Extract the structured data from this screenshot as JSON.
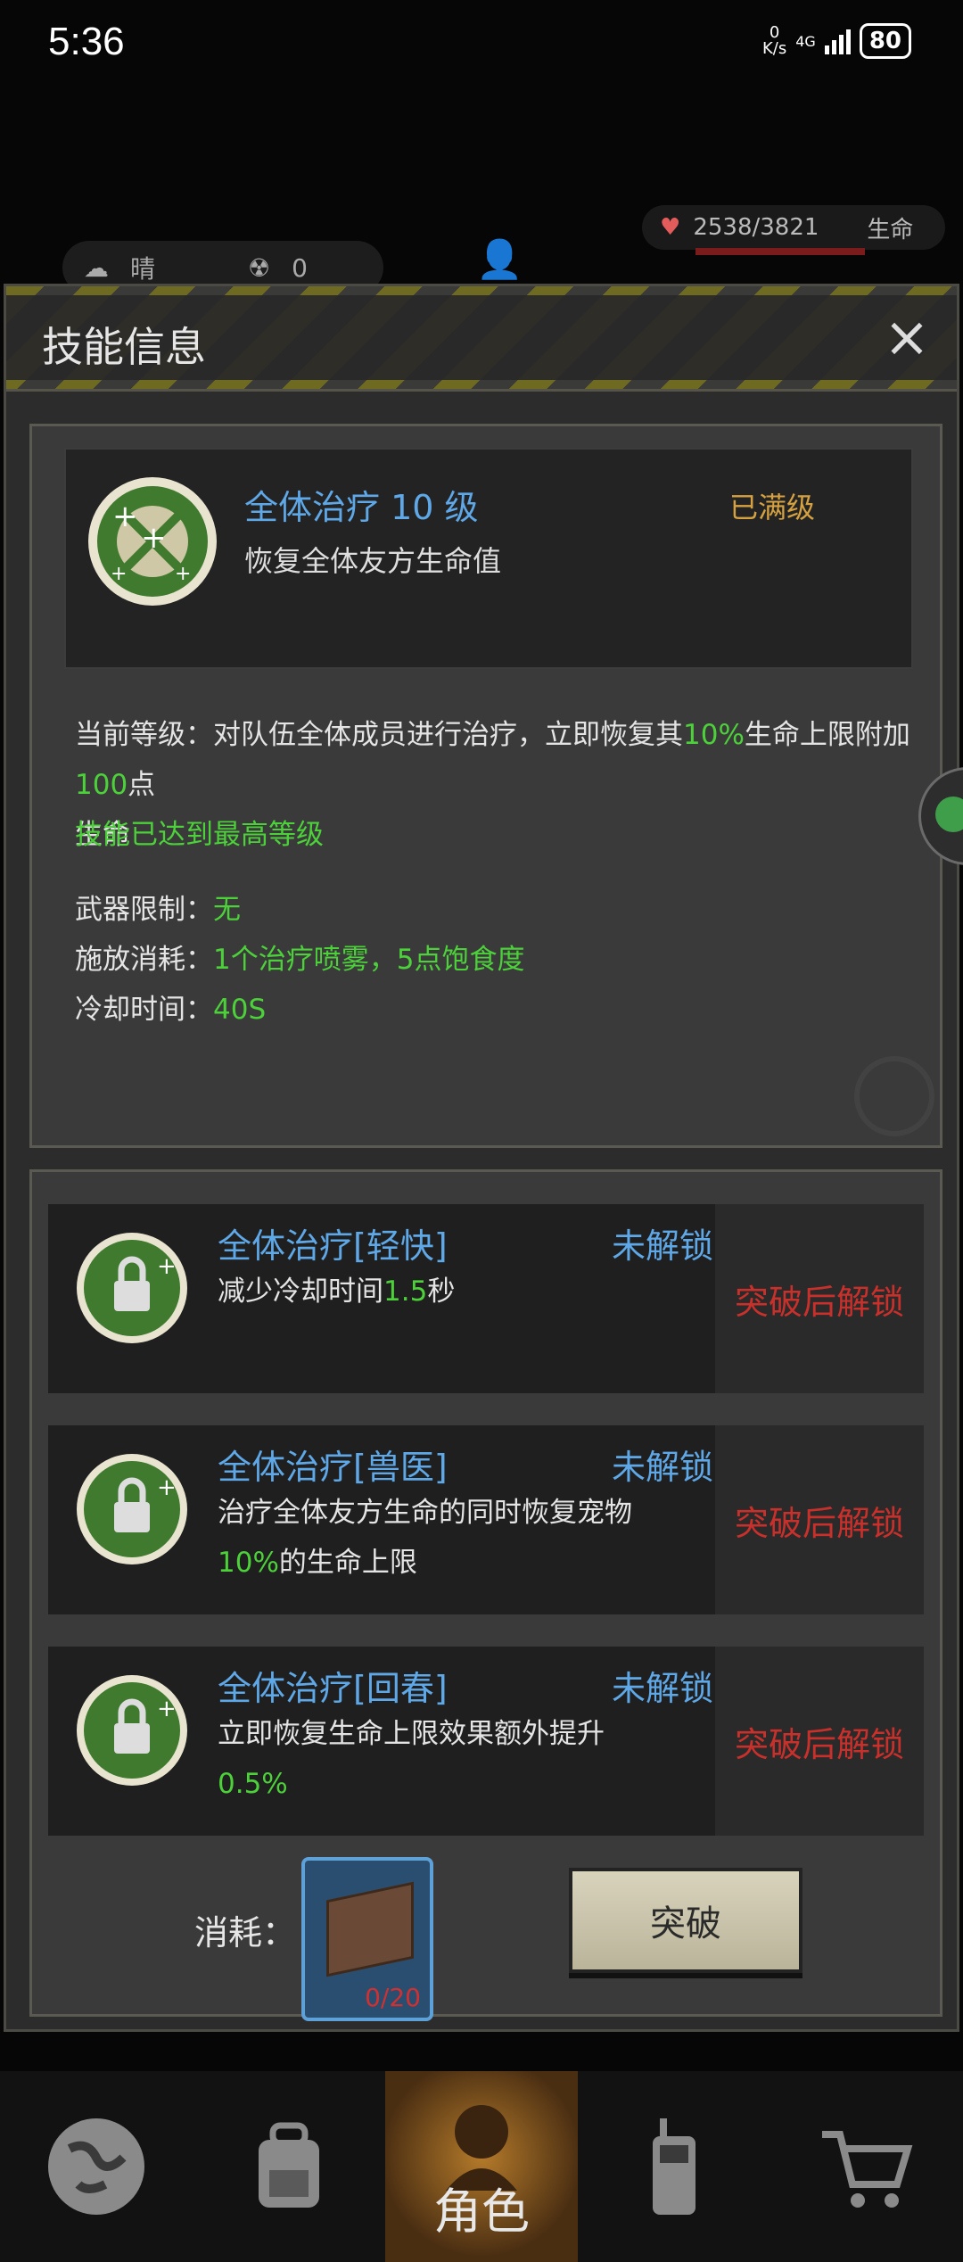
{
  "status_bar": {
    "time": "5:36",
    "speed_top": "0",
    "speed_unit": "K/s",
    "network": "4G",
    "battery": "80"
  },
  "hud": {
    "weather": "晴",
    "radiation": "0",
    "hp": "2538/3821",
    "hp_label": "生命"
  },
  "modal": {
    "title": "技能信息",
    "close_label": "×"
  },
  "skill": {
    "name": "全体治疗 10 级",
    "max_label": "已满级",
    "desc": "恢复全体友方生命值",
    "current_level_prefix": "当前等级：对队伍全体成员进行治疗，立即恢复其",
    "current_level_pct": "10%",
    "current_level_mid": "生命上限附加",
    "current_level_amount": "100",
    "current_level_suffix": "点",
    "current_level_line2": "生命",
    "max_reached": "技能已达到最高等级",
    "weapon_label": "武器限制：",
    "weapon_value": "无",
    "cost_label": "施放消耗：",
    "cost_value": "1个治疗喷雾，5点饱食度",
    "cooldown_label": "冷却时间：",
    "cooldown_value": "40S"
  },
  "talents": [
    {
      "name": "全体治疗[轻快]",
      "status": "未解锁",
      "desc_prefix": "减少冷却时间",
      "desc_value": "1.5",
      "desc_suffix": "秒",
      "lock_text": "突破后解锁"
    },
    {
      "name": "全体治疗[兽医]",
      "status": "未解锁",
      "desc_prefix": "治疗全体友方生命的同时恢复宠物",
      "desc_value": "10%",
      "desc_suffix": "的生命上限",
      "lock_text": "突破后解锁"
    },
    {
      "name": "全体治疗[回春]",
      "status": "未解锁",
      "desc_prefix": "立即恢复生命上限效果额外提升",
      "desc_value": "0.5%",
      "desc_suffix": "",
      "lock_text": "突破后解锁"
    }
  ],
  "breakthrough": {
    "cost_label": "消耗：",
    "item_count": "0/20",
    "button_label": "突破"
  },
  "bottom_nav": {
    "items": [
      {
        "icon": "globe-icon"
      },
      {
        "icon": "backpack-icon"
      },
      {
        "icon": "character-icon",
        "label": "角色"
      },
      {
        "icon": "radio-icon"
      },
      {
        "icon": "cart-icon"
      }
    ]
  },
  "colors": {
    "skill_name": "#5fa8e8",
    "max_label": "#d6a140",
    "highlight_green": "#4cd13a",
    "lock_red": "#c8302c"
  }
}
